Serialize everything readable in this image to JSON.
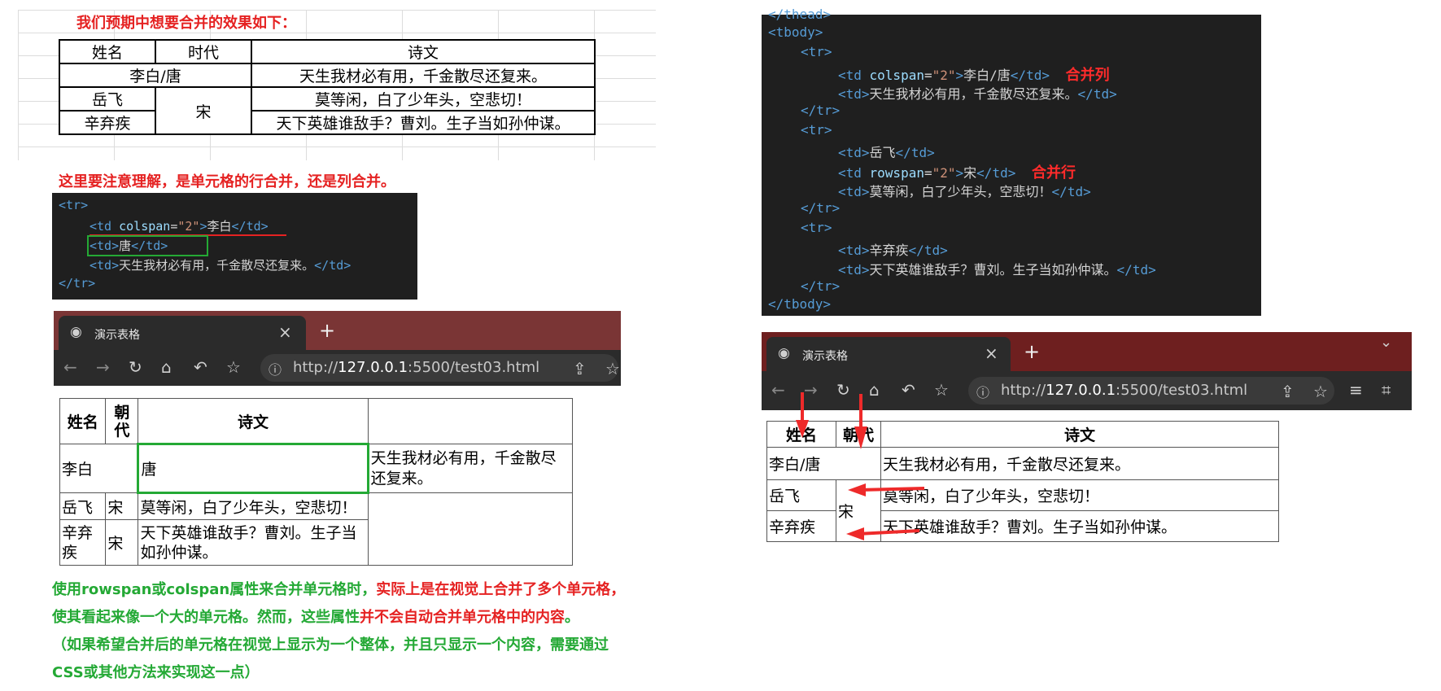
{
  "excel_note": "我们预期中想要合并的效果如下：",
  "excel_table": {
    "headers": [
      "姓名",
      "时代",
      "诗文"
    ],
    "row1": [
      "李白/唐",
      "天生我材必有用，千金散尽还复来。"
    ],
    "row2": [
      "岳飞",
      "宋",
      "莫等闲，白了少年头，空悲切！"
    ],
    "row3": [
      "辛弃疾",
      "天下英雄谁敌手？曹刘。生子当如孙仲谋。"
    ]
  },
  "attention_note": "这里要注意理解，是单元格的行合并，还是列合并。",
  "left_code": {
    "tr_open": "<tr>",
    "td1_open": "<td ",
    "td1_attr": "colspan",
    "td1_eq": "=",
    "td1_val": "\"2\"",
    "td1_close_lt": ">",
    "td1_text": "李白",
    "td1_end": "</td>",
    "td2_open": "<td>",
    "td2_text": "唐",
    "td2_end": "</td>",
    "td3_open": "<td>",
    "td3_text": "天生我材必有用，千金散尽还复来。",
    "td3_end": "</td>",
    "tr_close": "</tr>"
  },
  "right_code": {
    "top_fragment": "</thead>",
    "tbody_open": "<tbody>",
    "tr_open": "<tr>",
    "tr_close": "</tr>",
    "tbody_close": "</tbody>",
    "td_open": "<td>",
    "td_open_attr": "<td ",
    "td_end": "</td>",
    "gt": ">",
    "colspan": "colspan",
    "rowspan": "rowspan",
    "eq": "=",
    "val2": "\"2\"",
    "r1c1": "李白/唐",
    "r1c2": "天生我材必有用，千金散尽还复来。",
    "r2c1": "岳飞",
    "r2c2": "宋",
    "r2c3": "莫等闲，白了少年头，空悲切！",
    "r3c1": "辛弃疾",
    "r3c2": "天下英雄谁敌手？曹刘。生子当如孙仲谋。",
    "label_colspan": "合并列",
    "label_rowspan": "合并行"
  },
  "browser_left": {
    "tab_title": "演示表格",
    "close": "×",
    "new_tab": "+",
    "url_prefix": "http://",
    "url_host": "127.0.0.1",
    "url_rest": ":5500/test03.html"
  },
  "browser_right": {
    "tab_title": "演示表格",
    "close": "×",
    "new_tab": "+",
    "url_prefix": "http://",
    "url_host": "127.0.0.1",
    "url_rest": ":5500/test03.html",
    "chevron": "⌄"
  },
  "left_render": {
    "h1": "姓名",
    "h2": "朝代",
    "h3": "诗文",
    "r1c1": "李白",
    "r1c2": "唐",
    "r1c3": "天生我材必有用，千金散尽还复来。",
    "r2c1": "岳飞",
    "r2c2": "宋",
    "r2c3": "莫等闲，白了少年头，空悲切！",
    "r3c1": "辛弃疾",
    "r3c2": "宋",
    "r3c3": "天下英雄谁敌手？曹刘。生子当如孙仲谋。"
  },
  "right_render": {
    "h1": "姓名",
    "h2": "朝代",
    "h3": "诗文",
    "r1c1": "李白/唐",
    "r1c2": "天生我材必有用，千金散尽还复来。",
    "r2c1": "岳飞",
    "r2c2": "宋",
    "r2c3": "莫等闲，白了少年头，空悲切！",
    "r3c1": "辛弃疾",
    "r3c3": "天下英雄谁敌手？曹刘。生子当如孙仲谋。"
  },
  "bottom_note": {
    "l1_green": "使用rowspan或colspan属性来合并单元格时，",
    "l1_red": "实际上是在视觉上合并了多个单元格，",
    "l2_green": "使其看起来像一个大的单元格。然而，这些属性",
    "l2_red": "并不会自动合并单元格中的内容",
    "l2_end": "。",
    "l3": "（如果希望合并后的单元格在视觉上显示为一个整体，并且只显示一个内容，需要通过",
    "l4": "CSS或其他方法来实现这一点）"
  },
  "colors": {
    "red": "#e52222",
    "green": "#24a935",
    "code_bg": "#1f1f1f",
    "browser_dark": "#2b2b2b",
    "tabbar_left": "#7a3535",
    "tabbar_right": "#6e1f1f"
  },
  "icons": [
    "globe-icon",
    "close-icon",
    "plus-icon",
    "back-arrow-icon",
    "forward-arrow-icon",
    "reload-icon",
    "home-icon",
    "undo-icon",
    "star-icon",
    "info-icon",
    "share-icon",
    "playlist-icon",
    "crop-icon",
    "chevron-down-icon",
    "red-arrow-icon"
  ]
}
